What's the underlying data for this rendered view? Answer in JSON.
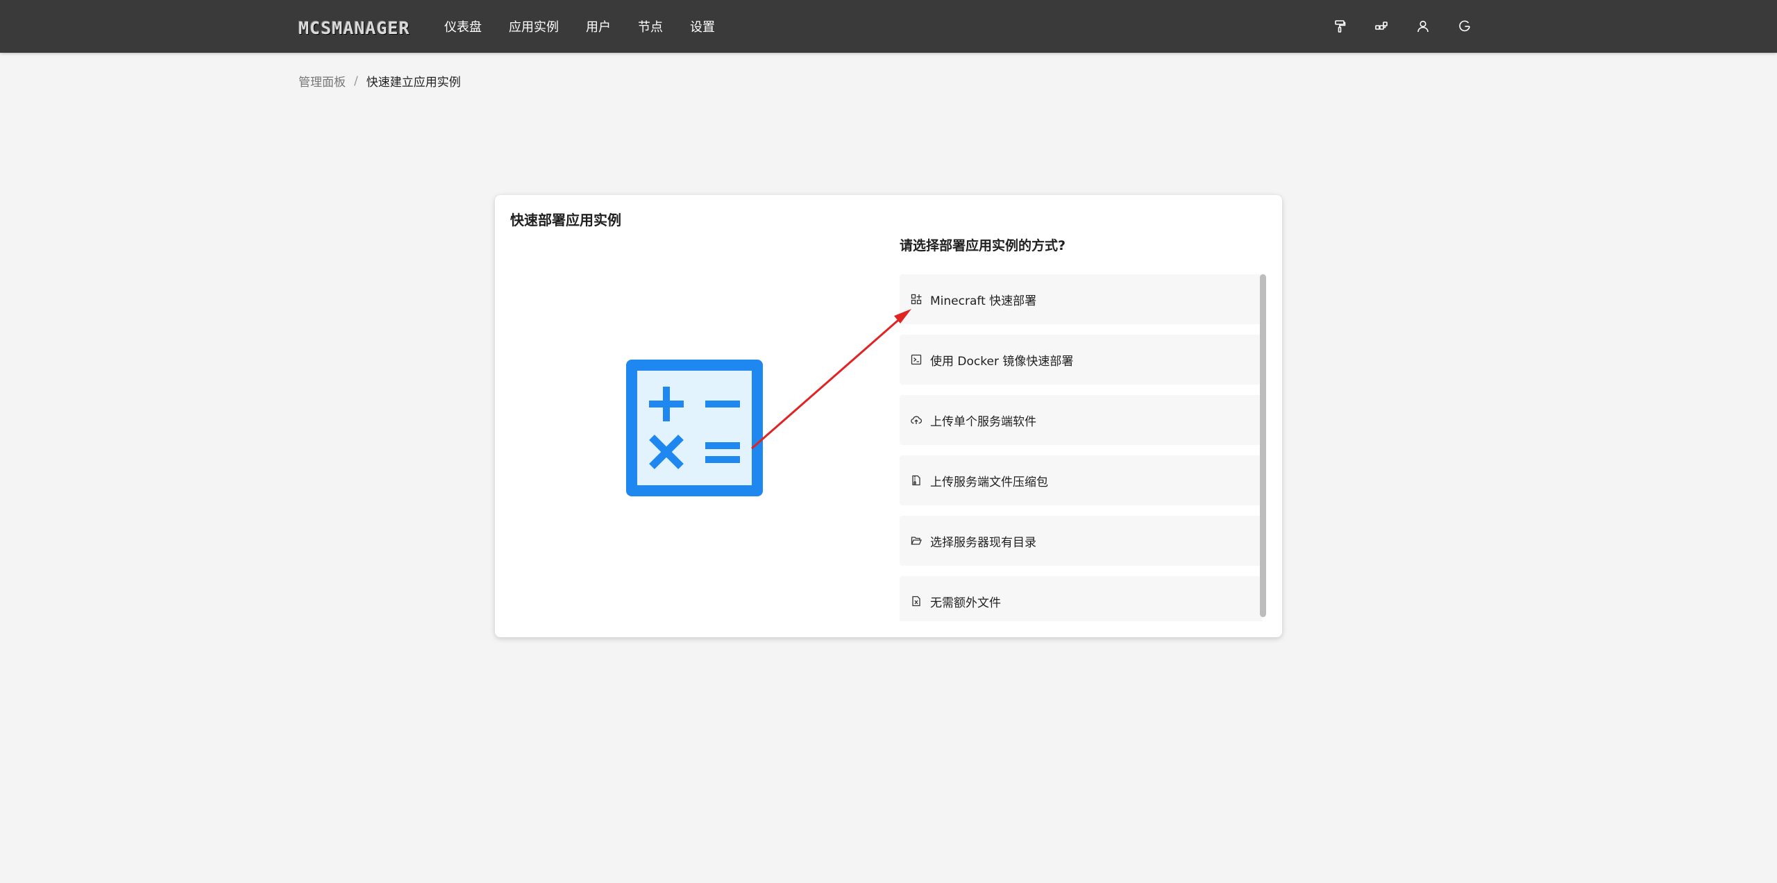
{
  "header": {
    "logo": "MCSMANAGER",
    "nav": [
      "仪表盘",
      "应用实例",
      "用户",
      "节点",
      "设置"
    ],
    "icons": [
      "paint-roller-icon",
      "cluster-icon",
      "user-icon",
      "logout-icon"
    ]
  },
  "breadcrumb": {
    "parent": "管理面板",
    "separator": "/",
    "current": "快速建立应用实例"
  },
  "card": {
    "title": "快速部署应用实例",
    "question": "请选择部署应用实例的方式?",
    "options": [
      {
        "label": "Minecraft 快速部署",
        "icon": "app-grid-icon"
      },
      {
        "label": "使用 Docker 镜像快速部署",
        "icon": "terminal-icon"
      },
      {
        "label": "上传单个服务端软件",
        "icon": "cloud-upload-icon"
      },
      {
        "label": "上传服务端文件压缩包",
        "icon": "file-zip-icon"
      },
      {
        "label": "选择服务器现有目录",
        "icon": "folder-open-icon"
      },
      {
        "label": "无需额外文件",
        "icon": "file-excel-icon"
      }
    ]
  },
  "colors": {
    "topbar": "#3a3a3a",
    "page_bg": "#f4f4f4",
    "accent_blue": "#1e88f0",
    "arrow_red": "#e02424"
  }
}
